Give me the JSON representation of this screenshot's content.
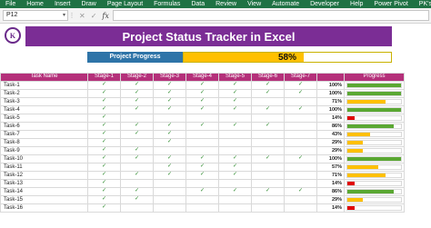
{
  "ribbon": {
    "tabs": [
      "File",
      "Home",
      "Insert",
      "Draw",
      "Page Layout",
      "Formulas",
      "Data",
      "Review",
      "View",
      "Automate",
      "Developer",
      "Help",
      "Power Pivot",
      "PK's Utility Tool V3.0"
    ]
  },
  "formula_bar": {
    "name_box": "P12",
    "fx_label": "fx"
  },
  "logo_text": "K",
  "title": "Project Status Tracker in Excel",
  "project_progress": {
    "label": "Project Progress",
    "value_text": "58%",
    "value": 0.58,
    "color": "#ffc000"
  },
  "table": {
    "headers": [
      "Task Name",
      "Stage-1",
      "Stage-2",
      "Stage-3",
      "Stage-4",
      "Stage-5",
      "Stage-6",
      "Stage-7",
      "",
      "Progress"
    ],
    "check_glyph": "✓",
    "rows": [
      {
        "task": "Task-1",
        "stages": [
          1,
          1,
          1,
          1,
          1,
          1,
          1
        ],
        "pct_text": "100%",
        "pct": 1.0,
        "color": "#5aa832"
      },
      {
        "task": "Task-2",
        "stages": [
          1,
          1,
          1,
          1,
          1,
          1,
          1
        ],
        "pct_text": "100%",
        "pct": 1.0,
        "color": "#5aa832"
      },
      {
        "task": "Task-3",
        "stages": [
          1,
          1,
          1,
          1,
          1,
          0,
          0
        ],
        "pct_text": "71%",
        "pct": 0.71,
        "color": "#ffc000"
      },
      {
        "task": "Task-4",
        "stages": [
          1,
          1,
          1,
          1,
          1,
          1,
          1
        ],
        "pct_text": "100%",
        "pct": 1.0,
        "color": "#5aa832"
      },
      {
        "task": "Task-5",
        "stages": [
          1,
          0,
          0,
          0,
          0,
          0,
          0
        ],
        "pct_text": "14%",
        "pct": 0.14,
        "color": "#e00000"
      },
      {
        "task": "Task-6",
        "stages": [
          1,
          1,
          1,
          1,
          1,
          1,
          0
        ],
        "pct_text": "86%",
        "pct": 0.86,
        "color": "#5aa832"
      },
      {
        "task": "Task-7",
        "stages": [
          1,
          1,
          1,
          0,
          0,
          0,
          0
        ],
        "pct_text": "43%",
        "pct": 0.43,
        "color": "#ffc000"
      },
      {
        "task": "Task-8",
        "stages": [
          1,
          0,
          1,
          0,
          0,
          0,
          0
        ],
        "pct_text": "29%",
        "pct": 0.29,
        "color": "#ffc000"
      },
      {
        "task": "Task-9",
        "stages": [
          1,
          1,
          0,
          0,
          0,
          0,
          0
        ],
        "pct_text": "29%",
        "pct": 0.29,
        "color": "#ffc000"
      },
      {
        "task": "Task-10",
        "stages": [
          1,
          1,
          1,
          1,
          1,
          1,
          1
        ],
        "pct_text": "100%",
        "pct": 1.0,
        "color": "#5aa832"
      },
      {
        "task": "Task-11",
        "stages": [
          1,
          0,
          1,
          1,
          1,
          0,
          0
        ],
        "pct_text": "57%",
        "pct": 0.57,
        "color": "#ffc000"
      },
      {
        "task": "Task-12",
        "stages": [
          1,
          1,
          1,
          1,
          1,
          0,
          0
        ],
        "pct_text": "71%",
        "pct": 0.71,
        "color": "#ffc000"
      },
      {
        "task": "Task-13",
        "stages": [
          1,
          0,
          0,
          0,
          0,
          0,
          0
        ],
        "pct_text": "14%",
        "pct": 0.14,
        "color": "#e00000"
      },
      {
        "task": "Task-14",
        "stages": [
          1,
          1,
          0,
          1,
          1,
          1,
          1
        ],
        "pct_text": "86%",
        "pct": 0.86,
        "color": "#5aa832"
      },
      {
        "task": "Task-15",
        "stages": [
          1,
          1,
          0,
          0,
          0,
          0,
          0
        ],
        "pct_text": "29%",
        "pct": 0.29,
        "color": "#ffc000"
      },
      {
        "task": "Task-16",
        "stages": [
          1,
          0,
          0,
          0,
          0,
          0,
          0
        ],
        "pct_text": "14%",
        "pct": 0.14,
        "color": "#e00000"
      }
    ]
  }
}
